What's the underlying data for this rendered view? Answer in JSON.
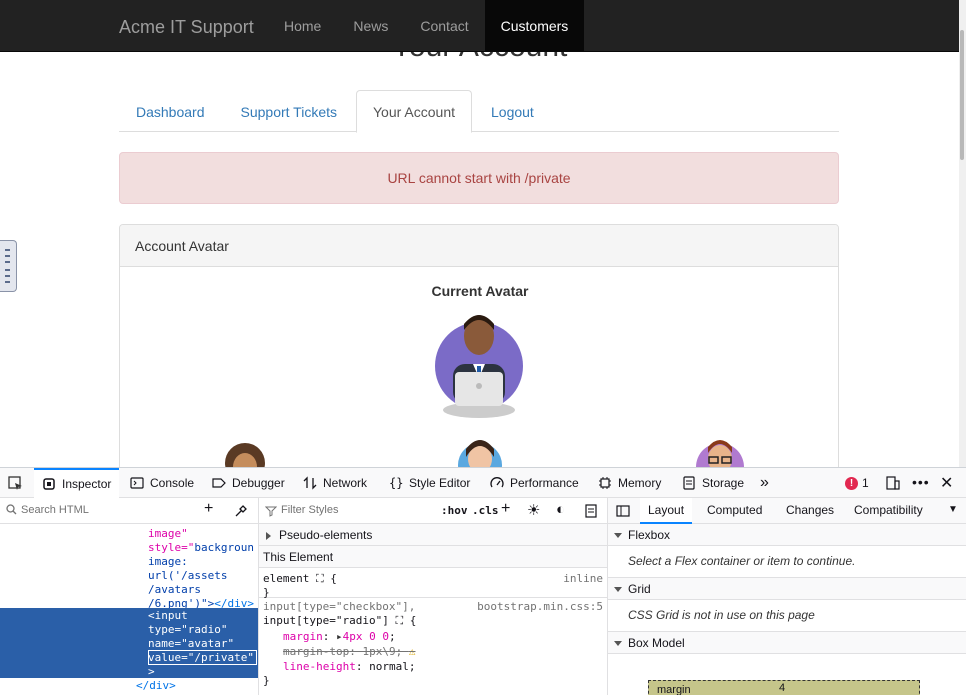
{
  "page": {
    "hidden_heading": "Your Account",
    "navbar": {
      "brand": "Acme IT Support",
      "links": [
        "Home",
        "News",
        "Contact",
        "Customers"
      ],
      "active": "Customers"
    },
    "tabs": [
      "Dashboard",
      "Support Tickets",
      "Your Account",
      "Logout"
    ],
    "active_tab": "Your Account",
    "alert": "URL cannot start with /private",
    "panel": {
      "heading": "Account Avatar",
      "current_avatar_label": "Current Avatar"
    }
  },
  "devtools": {
    "tabs": [
      "Inspector",
      "Console",
      "Debugger",
      "Network",
      "Style Editor",
      "Performance",
      "Memory",
      "Storage"
    ],
    "selected_tab": "Inspector",
    "error_count": "1",
    "html_search_placeholder": "Search HTML",
    "html_lines": {
      "l1": "image\"",
      "l2a": "style=\"",
      "l2b": "backgroun",
      "l3": "image:",
      "l4": "url('/assets",
      "l5": "/avatars",
      "l6a": "/6.png')\">",
      "l6b": "</div>",
      "l7a": "<input",
      "l8a": "type=",
      "l8b": "\"radio\"",
      "l9a": "name=",
      "l9b": "\"avatar\"",
      "l10a": "value=",
      "l10b": "\"/private\"",
      "l11": ">",
      "l12": "</div>"
    },
    "rules": {
      "filter_placeholder": "Filter Styles",
      "hov": ":hov",
      "cls": ".cls",
      "pseudo": "Pseudo-elements",
      "this_element": "This Element",
      "element_sel": "element",
      "element_src": "inline",
      "rule_sel_1": "input[type=\"checkbox\"],",
      "rule_sel_2": "input[type=\"radio\"]",
      "rule_src": "bootstrap.min.css:5",
      "prop1": "margin",
      "val1": "4px 0 0",
      "prop2": "margin-top",
      "val2": "1px\\9",
      "prop3": "line-height",
      "val3": "normal"
    },
    "layout": {
      "tabs": [
        "Layout",
        "Computed",
        "Changes",
        "Compatibility"
      ],
      "selected": "Layout",
      "flexbox": "Flexbox",
      "flexbox_note": "Select a Flex container or item to continue.",
      "grid": "Grid",
      "grid_note": "CSS Grid is not in use on this page",
      "box_model": "Box Model",
      "margin_label": "margin",
      "margin_top": "4"
    }
  },
  "colors": {
    "navbar_bg": "#222222",
    "link": "#337ab7",
    "alert_bg": "#f2dede",
    "alert_text": "#a94442",
    "devtools_accent": "#0a84ff",
    "selection": "#2a5fa8"
  }
}
